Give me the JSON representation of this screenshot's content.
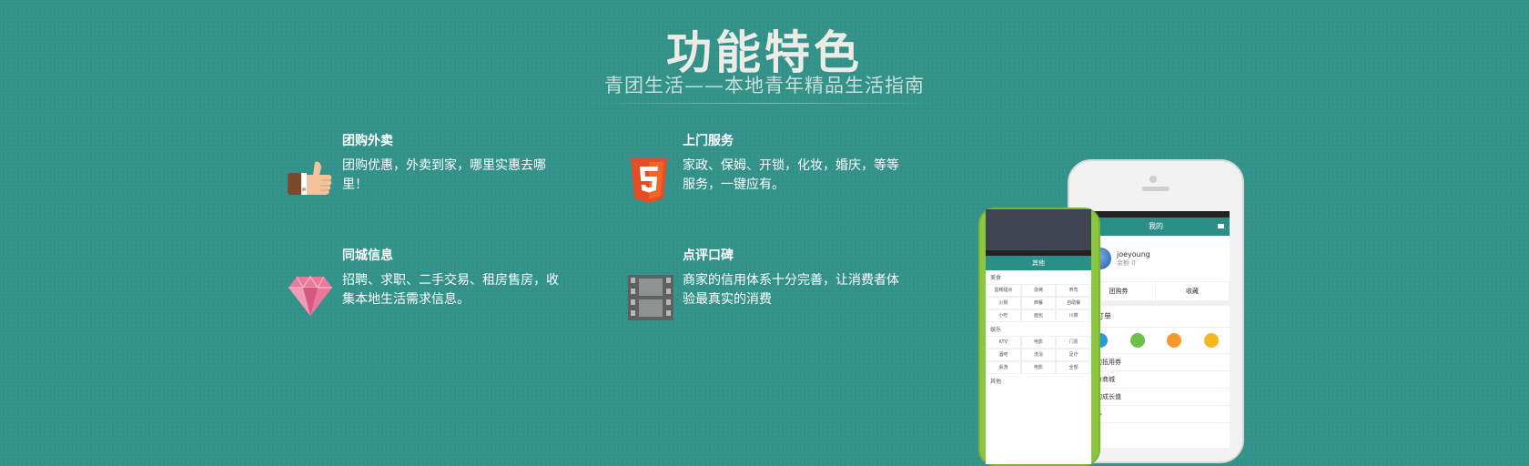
{
  "header": {
    "title": "功能特色",
    "subtitle": "青团生活——本地青年精品生活指南"
  },
  "features": [
    {
      "title": "团购外卖",
      "desc": "团购优惠，外卖到家，哪里实惠去哪里！",
      "icon": "thumbs-up-icon"
    },
    {
      "title": "上门服务",
      "desc": "家政、保姆、开锁，化妆，婚庆，等等服务，一键应有。",
      "icon": "html5-icon"
    },
    {
      "title": "同城信息",
      "desc": "招聘、求职、二手交易、租房售房，收集本地生活需求信息。",
      "icon": "diamond-icon"
    },
    {
      "title": "点评口碑",
      "desc": "商家的信用体系十分完善，让消费者体验最真实的消费",
      "icon": "film-icon"
    }
  ],
  "phone_back": {
    "header": "我的",
    "username": "joeyoung",
    "balance": "余额 0",
    "tabs": [
      "团购券",
      "收藏"
    ],
    "orders_title": "购订单",
    "order_icon_colors": [
      "#2d9ad8",
      "#6cc04a",
      "#f39a2b",
      "#f5b61f"
    ],
    "list": [
      "我的抵用券",
      "积分商城",
      "我的成长值",
      "更多"
    ]
  },
  "phone_front": {
    "header": "其他",
    "section1": "美食",
    "grid1": [
      "蛋糕甜点",
      "烧烤",
      "寿司",
      "火锅",
      "西餐",
      "自助餐",
      "小吃",
      "面包",
      "川菜"
    ],
    "section2": "娱乐",
    "grid2": [
      "KTV",
      "电影",
      "门票",
      "酒吧",
      "洗浴",
      "足疗",
      "桌游",
      "电影",
      "全部"
    ],
    "section3": "其他"
  },
  "colors": {
    "background": "#33928a",
    "title": "#ecebe6",
    "app_header": "#2a8f87",
    "phone_green": "#8bc63f"
  }
}
